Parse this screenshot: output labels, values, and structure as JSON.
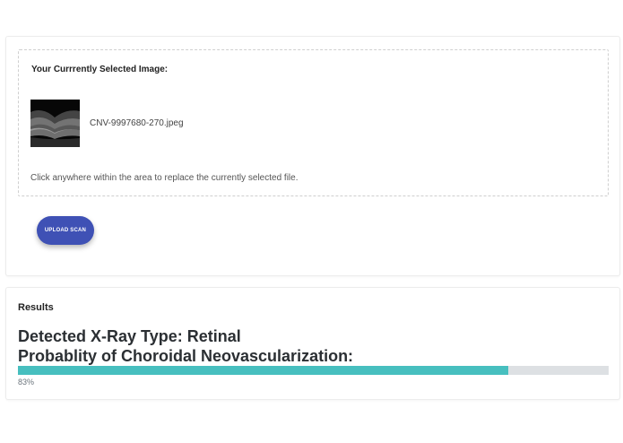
{
  "upload": {
    "heading": "Your Currrently Selected Image:",
    "filename": "CNV-9997680-270.jpeg",
    "hint": "Click anywhere within the area to replace the currently selected file.",
    "button_label": "UPLOAD SCAN",
    "thumbnail_icon": "oct-scan-thumbnail"
  },
  "results": {
    "title": "Results",
    "xray_type_line": "Detected X-Ray Type: Retinal",
    "probability_line": "Probablity of Choroidal Neovascularization:",
    "probability_percent": 83,
    "probability_label": "83%"
  },
  "colors": {
    "button": "#3f51b5",
    "progress_fill": "#47bfbf",
    "progress_track": "#dde0e3"
  }
}
